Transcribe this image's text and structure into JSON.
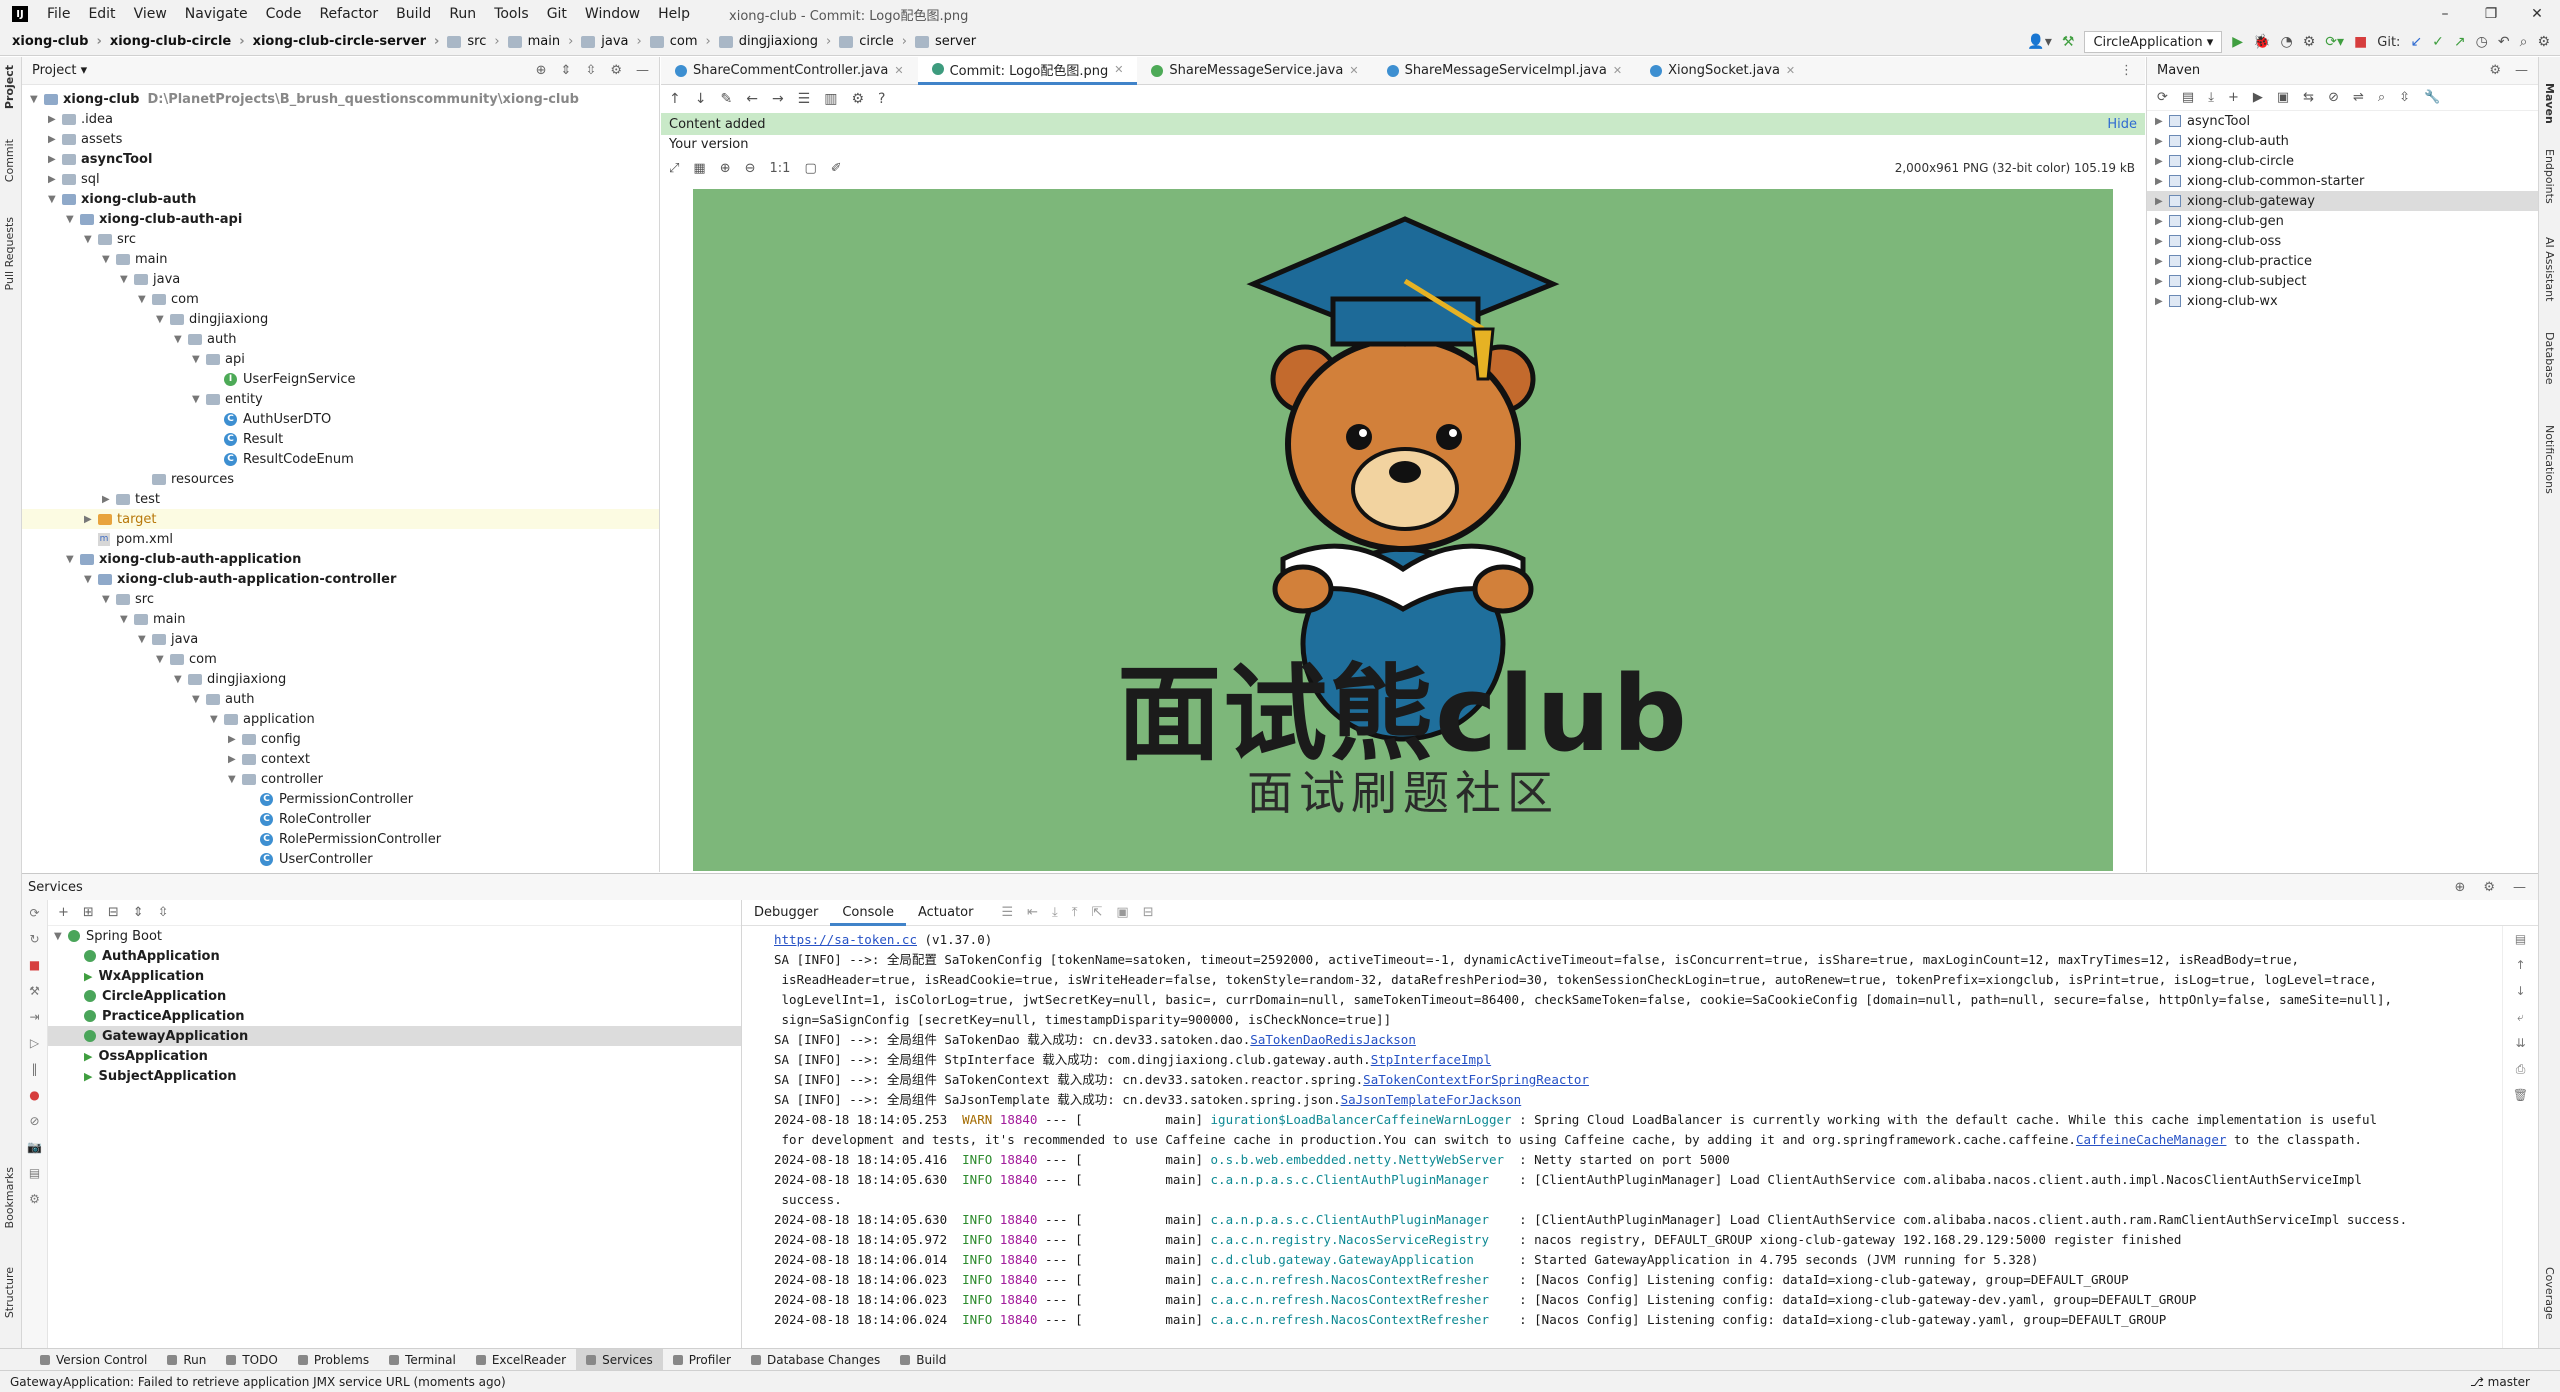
{
  "menubar": {
    "items": [
      "File",
      "Edit",
      "View",
      "Navigate",
      "Code",
      "Refactor",
      "Build",
      "Run",
      "Tools",
      "Git",
      "Window",
      "Help"
    ],
    "title": "xiong-club - Commit: Logo配色图.png"
  },
  "breadcrumb": [
    "xiong-club",
    "xiong-club-circle",
    "xiong-club-circle-server",
    "src",
    "main",
    "java",
    "com",
    "dingjiaxiong",
    "circle",
    "server"
  ],
  "run_config": "CircleApplication",
  "git_label": "Git:",
  "project": {
    "header": "Project",
    "root": "xiong-club",
    "root_path": "D:\\PlanetProjects\\B_brush_questionscommunity\\xiong-club",
    "nodes": [
      "xiong-club",
      ".idea",
      "assets",
      "asyncTool",
      "sql",
      "xiong-club-auth",
      "xiong-club-auth-api",
      "src",
      "main",
      "java",
      "com",
      "dingjiaxiong",
      "auth",
      "api",
      "UserFeignService",
      "entity",
      "AuthUserDTO",
      "Result",
      "ResultCodeEnum",
      "resources",
      "test",
      "target",
      "pom.xml",
      "xiong-club-auth-application",
      "xiong-club-auth-application-controller",
      "src",
      "main",
      "java",
      "com",
      "dingjiaxiong",
      "auth",
      "application",
      "config",
      "context",
      "controller",
      "PermissionController",
      "RoleController",
      "RolePermissionController",
      "UserController"
    ]
  },
  "editor": {
    "tabs": [
      "ShareCommentController.java",
      "Commit: Logo配色图.png",
      "ShareMessageService.java",
      "ShareMessageServiceImpl.java",
      "XiongSocket.java"
    ],
    "active_tab": 1,
    "banner": "Content added",
    "banner_action": "Hide",
    "your_version": "Your version",
    "image_info": "2,000x961 PNG (32-bit color) 105.19 kB",
    "zoom_label": "1:1",
    "logo_main": "面试熊club",
    "logo_sub": "面试刷题社区"
  },
  "maven": {
    "header": "Maven",
    "items": [
      "asyncTool",
      "xiong-club-auth",
      "xiong-club-circle",
      "xiong-club-common-starter",
      "xiong-club-gateway",
      "xiong-club-gen",
      "xiong-club-oss",
      "xiong-club-practice",
      "xiong-club-subject",
      "xiong-club-wx"
    ],
    "selected": "xiong-club-gateway"
  },
  "services": {
    "header": "Services",
    "group": "Spring Boot",
    "apps": [
      "AuthApplication",
      "WxApplication",
      "CircleApplication",
      "PracticeApplication",
      "GatewayApplication",
      "OssApplication",
      "SubjectApplication"
    ],
    "selected": "GatewayApplication",
    "console_tabs": [
      "Debugger",
      "Console",
      "Actuator"
    ]
  },
  "console": {
    "lines": [
      {
        "parts": [
          {
            "t": "https://sa-token.cc",
            "c": "link"
          },
          {
            "t": " (v1.37.0)"
          }
        ]
      },
      {
        "parts": [
          {
            "t": "SA [INFO] -->: 全局配置 SaTokenConfig [tokenName=satoken, timeout=2592000, activeTimeout=-1, dynamicActiveTimeout=false, isConcurrent=true, isShare=true, maxLoginCount=12, maxTryTimes=12, isReadBody=true,"
          }
        ]
      },
      {
        "parts": [
          {
            "t": " isReadHeader=true, isReadCookie=true, isWriteHeader=false, tokenStyle=random-32, dataRefreshPeriod=30, tokenSessionCheckLogin=true, autoRenew=true, tokenPrefix=xiongclub, isPrint=true, isLog=true, logLevel=trace,"
          }
        ]
      },
      {
        "parts": [
          {
            "t": " logLevelInt=1, isColorLog=true, jwtSecretKey=null, basic=, currDomain=null, sameTokenTimeout=86400, checkSameToken=false, cookie=SaCookieConfig [domain=null, path=null, secure=false, httpOnly=false, sameSite=null],"
          }
        ]
      },
      {
        "parts": [
          {
            "t": " sign=SaSignConfig [secretKey=null, timestampDisparity=900000, isCheckNonce=true]]"
          }
        ]
      },
      {
        "parts": [
          {
            "t": "SA [INFO] -->: 全局组件 SaTokenDao 载入成功: cn.dev33.satoken.dao."
          },
          {
            "t": "SaTokenDaoRedisJackson",
            "c": "link"
          }
        ]
      },
      {
        "parts": [
          {
            "t": "SA [INFO] -->: 全局组件 StpInterface 载入成功: com.dingjiaxiong.club.gateway.auth."
          },
          {
            "t": "StpInterfaceImpl",
            "c": "link"
          }
        ]
      },
      {
        "parts": [
          {
            "t": "SA [INFO] -->: 全局组件 SaTokenContext 载入成功: cn.dev33.satoken.reactor.spring."
          },
          {
            "t": "SaTokenContextForSpringReactor",
            "c": "link"
          }
        ]
      },
      {
        "parts": [
          {
            "t": "SA [INFO] -->: 全局组件 SaJsonTemplate 载入成功: cn.dev33.satoken.spring.json."
          },
          {
            "t": "SaJsonTemplateForJackson",
            "c": "link"
          }
        ]
      },
      {
        "parts": [
          {
            "t": "2024-08-18 18:14:05.253  "
          },
          {
            "t": "WARN",
            "c": "warn"
          },
          {
            "t": " "
          },
          {
            "t": "18840",
            "c": "pid"
          },
          {
            "t": " --- [           main] "
          },
          {
            "t": "iguration$LoadBalancerCaffeineWarnLogger",
            "c": "cyan"
          },
          {
            "t": " : Spring Cloud LoadBalancer is currently working with the default cache. While this cache implementation is useful"
          }
        ]
      },
      {
        "parts": [
          {
            "t": " for development and tests, it's recommended to use Caffeine cache in production.You can switch to using Caffeine cache, by adding it and org.springframework.cache.caffeine."
          },
          {
            "t": "CaffeineCacheManager",
            "c": "link"
          },
          {
            "t": " to the classpath."
          }
        ]
      },
      {
        "parts": [
          {
            "t": "2024-08-18 18:14:05.416  "
          },
          {
            "t": "INFO",
            "c": "info"
          },
          {
            "t": " "
          },
          {
            "t": "18840",
            "c": "pid"
          },
          {
            "t": " --- [           main] "
          },
          {
            "t": "o.s.b.web.embedded.netty.NettyWebServer",
            "c": "cyan"
          },
          {
            "t": "  : Netty started on port 5000"
          }
        ]
      },
      {
        "parts": [
          {
            "t": "2024-08-18 18:14:05.630  "
          },
          {
            "t": "INFO",
            "c": "info"
          },
          {
            "t": " "
          },
          {
            "t": "18840",
            "c": "pid"
          },
          {
            "t": " --- [           main] "
          },
          {
            "t": "c.a.n.p.a.s.c.ClientAuthPluginManager",
            "c": "cyan"
          },
          {
            "t": "    : [ClientAuthPluginManager] Load ClientAuthService com.alibaba.nacos.client.auth.impl.NacosClientAuthServiceImpl"
          }
        ]
      },
      {
        "parts": [
          {
            "t": " success."
          }
        ]
      },
      {
        "parts": [
          {
            "t": "2024-08-18 18:14:05.630  "
          },
          {
            "t": "INFO",
            "c": "info"
          },
          {
            "t": " "
          },
          {
            "t": "18840",
            "c": "pid"
          },
          {
            "t": " --- [           main] "
          },
          {
            "t": "c.a.n.p.a.s.c.ClientAuthPluginManager",
            "c": "cyan"
          },
          {
            "t": "    : [ClientAuthPluginManager] Load ClientAuthService com.alibaba.nacos.client.auth.ram.RamClientAuthServiceImpl success."
          }
        ]
      },
      {
        "parts": [
          {
            "t": "2024-08-18 18:14:05.972  "
          },
          {
            "t": "INFO",
            "c": "info"
          },
          {
            "t": " "
          },
          {
            "t": "18840",
            "c": "pid"
          },
          {
            "t": " --- [           main] "
          },
          {
            "t": "c.a.c.n.registry.NacosServiceRegistry",
            "c": "cyan"
          },
          {
            "t": "    : nacos registry, DEFAULT_GROUP xiong-club-gateway 192.168.29.129:5000 register finished"
          }
        ]
      },
      {
        "parts": [
          {
            "t": "2024-08-18 18:14:06.014  "
          },
          {
            "t": "INFO",
            "c": "info"
          },
          {
            "t": " "
          },
          {
            "t": "18840",
            "c": "pid"
          },
          {
            "t": " --- [           main] "
          },
          {
            "t": "c.d.club.gateway.GatewayApplication",
            "c": "cyan"
          },
          {
            "t": "      : Started GatewayApplication in 4.795 seconds (JVM running for 5.328)"
          }
        ]
      },
      {
        "parts": [
          {
            "t": "2024-08-18 18:14:06.023  "
          },
          {
            "t": "INFO",
            "c": "info"
          },
          {
            "t": " "
          },
          {
            "t": "18840",
            "c": "pid"
          },
          {
            "t": " --- [           main] "
          },
          {
            "t": "c.a.c.n.refresh.NacosContextRefresher",
            "c": "cyan"
          },
          {
            "t": "    : [Nacos Config] Listening config: dataId=xiong-club-gateway, group=DEFAULT_GROUP"
          }
        ]
      },
      {
        "parts": [
          {
            "t": "2024-08-18 18:14:06.023  "
          },
          {
            "t": "INFO",
            "c": "info"
          },
          {
            "t": " "
          },
          {
            "t": "18840",
            "c": "pid"
          },
          {
            "t": " --- [           main] "
          },
          {
            "t": "c.a.c.n.refresh.NacosContextRefresher",
            "c": "cyan"
          },
          {
            "t": "    : [Nacos Config] Listening config: dataId=xiong-club-gateway-dev.yaml, group=DEFAULT_GROUP"
          }
        ]
      },
      {
        "parts": [
          {
            "t": "2024-08-18 18:14:06.024  "
          },
          {
            "t": "INFO",
            "c": "info"
          },
          {
            "t": " "
          },
          {
            "t": "18840",
            "c": "pid"
          },
          {
            "t": " --- [           main] "
          },
          {
            "t": "c.a.c.n.refresh.NacosContextRefresher",
            "c": "cyan"
          },
          {
            "t": "    : [Nacos Config] Listening config: dataId=xiong-club-gateway.yaml, group=DEFAULT_GROUP"
          }
        ]
      }
    ]
  },
  "left_strip": [
    "Project",
    "Commit",
    "Pull Requests",
    "Bookmarks",
    "Structure"
  ],
  "right_strip": [
    "Maven",
    "Endpoints",
    "AI Assistant",
    "Database",
    "Notifications",
    "Coverage"
  ],
  "bottom_tabs": [
    "Version Control",
    "Run",
    "TODO",
    "Problems",
    "Terminal",
    "ExcelReader",
    "Services",
    "Profiler",
    "Database Changes",
    "Build"
  ],
  "bottom_active": "Services",
  "status": {
    "message": "GatewayApplication: Failed to retrieve application JMX service URL (moments ago)",
    "branch": "master"
  },
  "colors": {
    "accent": "#4083c9",
    "logo_bg": "#7db77a",
    "banner_bg": "#c9e9c8"
  }
}
